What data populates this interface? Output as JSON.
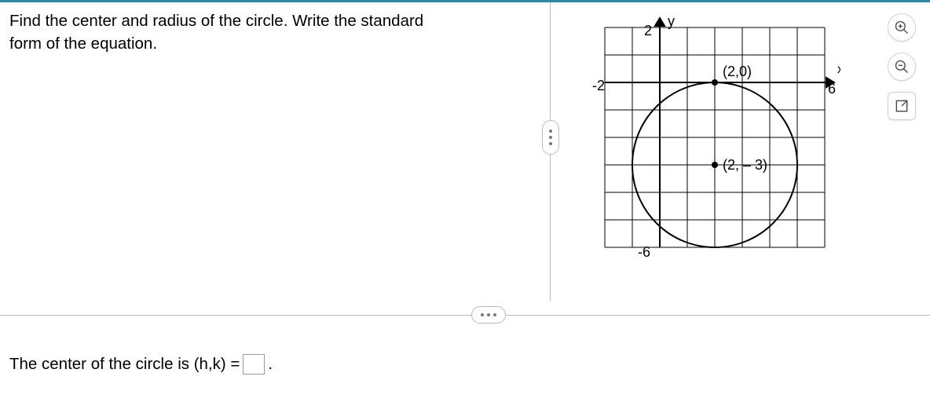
{
  "question": {
    "line1": "Find the center and radius of the circle. Write the standard",
    "line2": "form of the equation."
  },
  "answer": {
    "prefix": "The center of the circle is (h,k) = ",
    "suffix": "."
  },
  "chart_data": {
    "type": "scatter",
    "title": "",
    "xlabel": "x",
    "ylabel": "y",
    "xlim": [
      -2,
      6
    ],
    "ylim": [
      -6,
      2
    ],
    "xticks": [
      -2,
      6
    ],
    "yticks": [
      -6,
      2
    ],
    "grid": true,
    "points": [
      {
        "x": 2,
        "y": 0,
        "label": "(2,0)"
      },
      {
        "x": 2,
        "y": -3,
        "label": "(2, – 3)"
      }
    ],
    "circle": {
      "cx": 2,
      "cy": -3,
      "r": 3
    }
  },
  "tools": {
    "zoom_in": "zoom-in",
    "zoom_out": "zoom-out",
    "expand": "expand"
  }
}
